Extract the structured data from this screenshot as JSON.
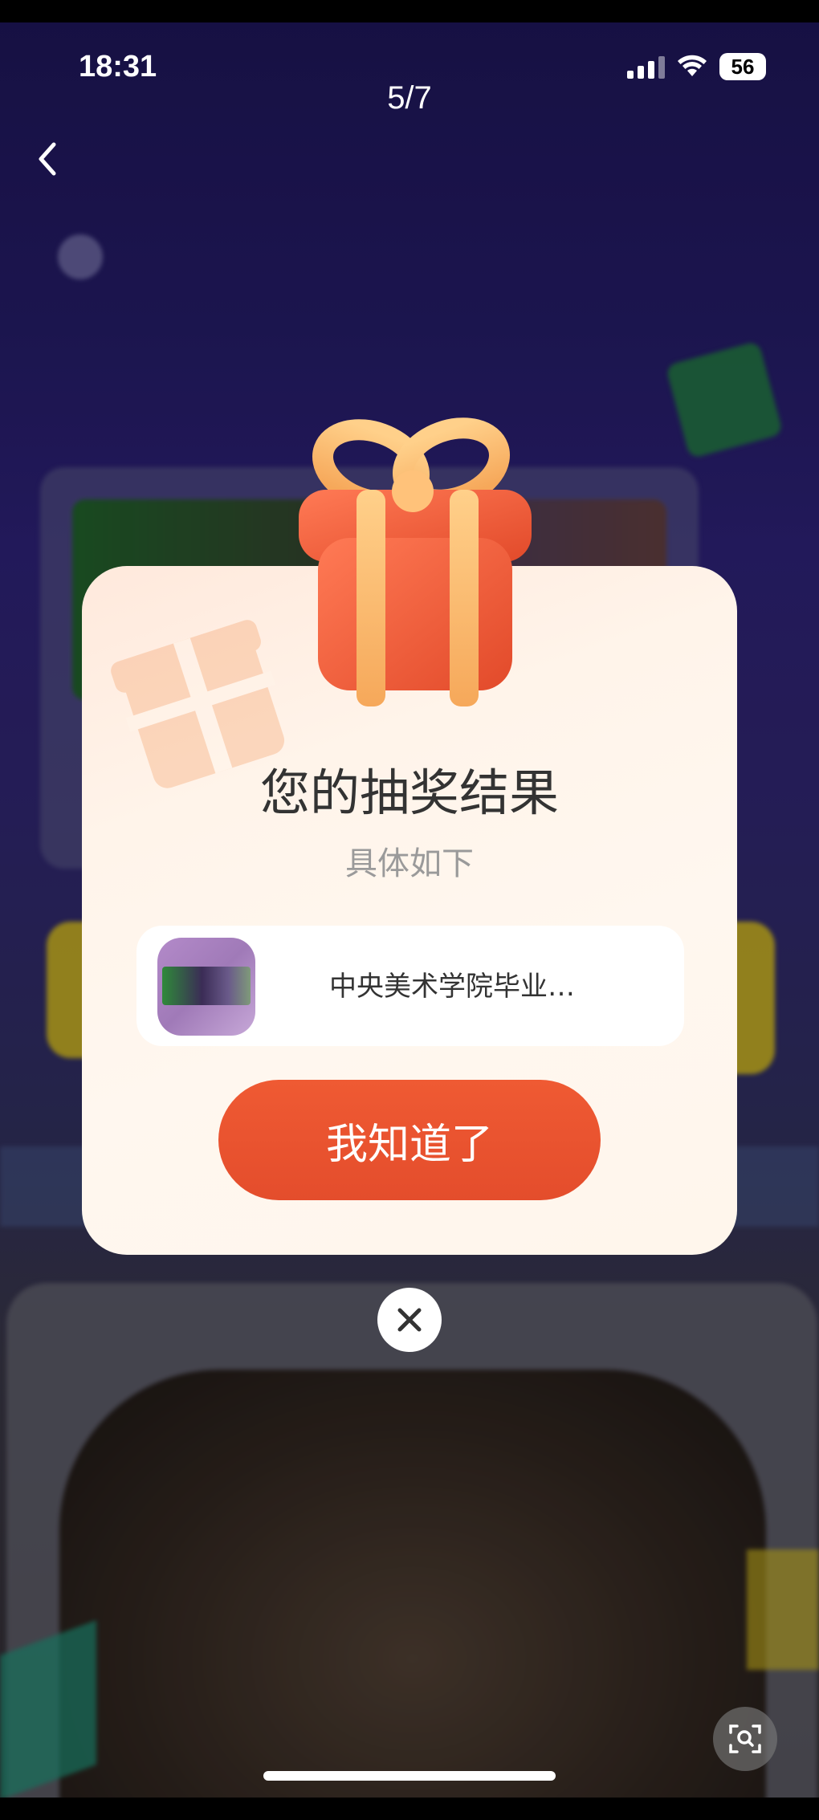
{
  "status_bar": {
    "time": "18:31",
    "battery": "56",
    "signal_icon": "signal-bars-icon",
    "wifi_icon": "wifi-icon"
  },
  "viewer": {
    "page_indicator": "5/7",
    "back_icon": "chevron-left-icon"
  },
  "modal": {
    "title": "您的抽奖结果",
    "subtitle": "具体如下",
    "prize": {
      "name": "中央美术学院毕业…"
    },
    "confirm_label": "我知道了",
    "icon": "gift-box-icon",
    "close_icon": "close-icon"
  },
  "colors": {
    "accent": "#e94e2c",
    "modal_bg": "#fff6ec",
    "title_text": "#333333",
    "subtitle_text": "#9a9a9a"
  },
  "tools": {
    "lens_icon": "visual-search-icon"
  }
}
